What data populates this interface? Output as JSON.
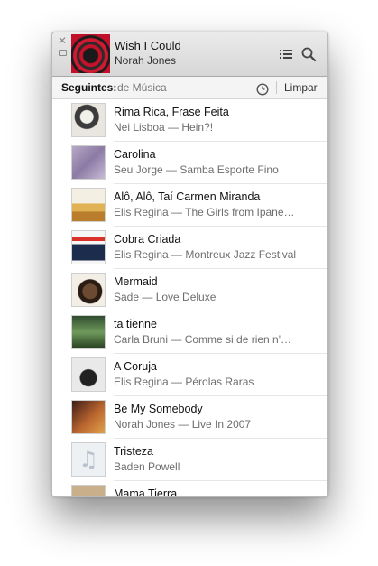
{
  "now_playing": {
    "title": "Wish I Could",
    "artist": "Norah Jones"
  },
  "icons": {
    "close": "close-icon",
    "minimize": "minimize-icon",
    "list": "list-icon",
    "search": "search-icon",
    "history": "clock-icon",
    "placeholder_art": "music-note-icon"
  },
  "up_next": {
    "label": "Seguintes:",
    "source": "de Música",
    "clear_label": "Limpar"
  },
  "tracks": [
    {
      "title": "Rima Rica, Frase Feita",
      "subtitle": "Nei Lisboa — Hein?!"
    },
    {
      "title": "Carolina",
      "subtitle": "Seu Jorge — Samba Esporte Fino"
    },
    {
      "title": "Alô, Alô, Taí Carmen Miranda",
      "subtitle": "Elis Regina — The Girls from Ipane…"
    },
    {
      "title": "Cobra Criada",
      "subtitle": "Elis Regina — Montreux Jazz Festival"
    },
    {
      "title": "Mermaid",
      "subtitle": "Sade — Love Deluxe"
    },
    {
      "title": "ta tienne",
      "subtitle": "Carla Bruni — Comme si de rien n'…"
    },
    {
      "title": "A Coruja",
      "subtitle": "Elis Regina — Pérolas Raras"
    },
    {
      "title": "Be My Somebody",
      "subtitle": "Norah Jones — Live In 2007"
    },
    {
      "title": "Tristeza",
      "subtitle": "Baden Powell"
    },
    {
      "title": "Mama Tierra",
      "subtitle": ""
    }
  ]
}
